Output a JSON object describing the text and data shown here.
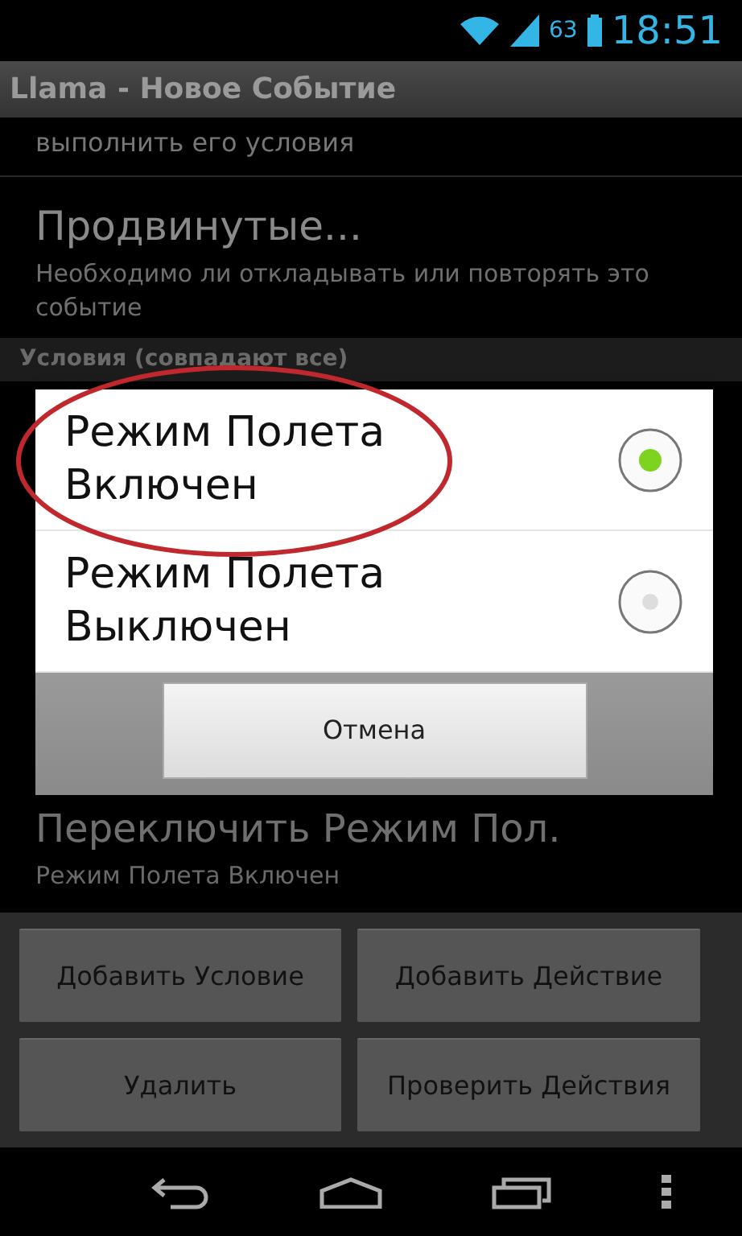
{
  "status_bar": {
    "battery": "63",
    "time": "18:51"
  },
  "title": "Llama - Новое Событие",
  "top_item_tail": "выполнить его условия",
  "advanced": {
    "title": "Продвинутые...",
    "subtitle": "Необходимо ли откладывать или повторять это событие"
  },
  "conditions_header": "Условия (совпадают все)",
  "action_item": {
    "title": "Переключить Режим Пол.",
    "subtitle": "Режим Полета Включен"
  },
  "dialog": {
    "options": [
      {
        "label": "Режим Полета Включен",
        "selected": true,
        "circled": true
      },
      {
        "label": "Режим Полета Выключен",
        "selected": false,
        "circled": false
      }
    ],
    "cancel": "Отмена"
  },
  "buttons": [
    "Добавить Условие",
    "Добавить Действие",
    "Удалить",
    "Проверить Действия"
  ]
}
